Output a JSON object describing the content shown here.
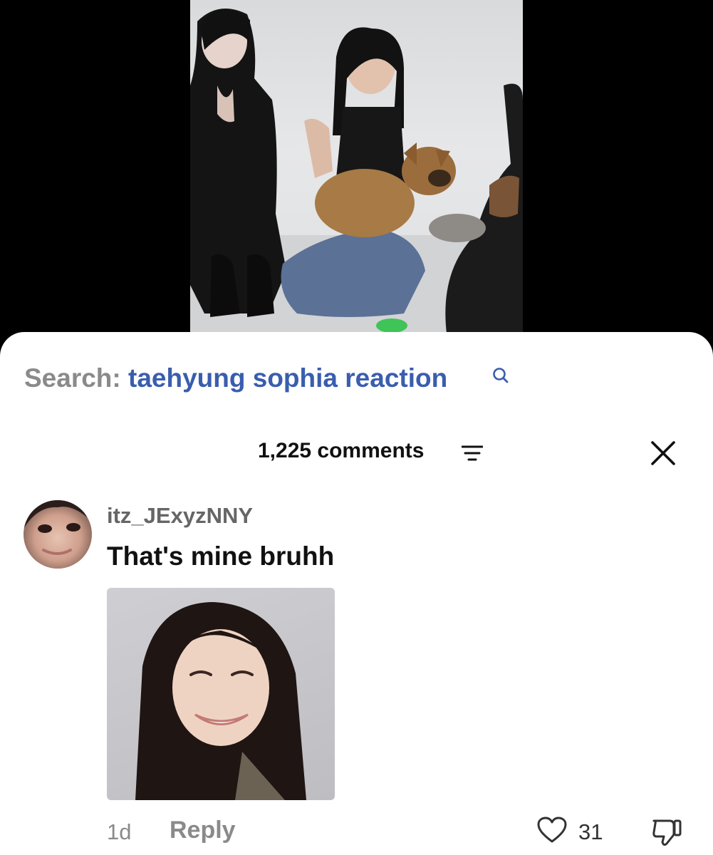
{
  "search": {
    "prefix": "Search:",
    "query": "taehyung sophia reaction"
  },
  "comments": {
    "count_label": "1,225 comments",
    "icons": {
      "sort": "sort-lines-icon",
      "close": "close-icon"
    }
  },
  "comment": {
    "username": "itz_JExyzNNY",
    "text": "That's mine bruhh",
    "time": "1d",
    "reply_label": "Reply",
    "likes": "31"
  },
  "colors": {
    "search_prefix": "#8a8a8a",
    "search_query": "#3a5dae"
  }
}
